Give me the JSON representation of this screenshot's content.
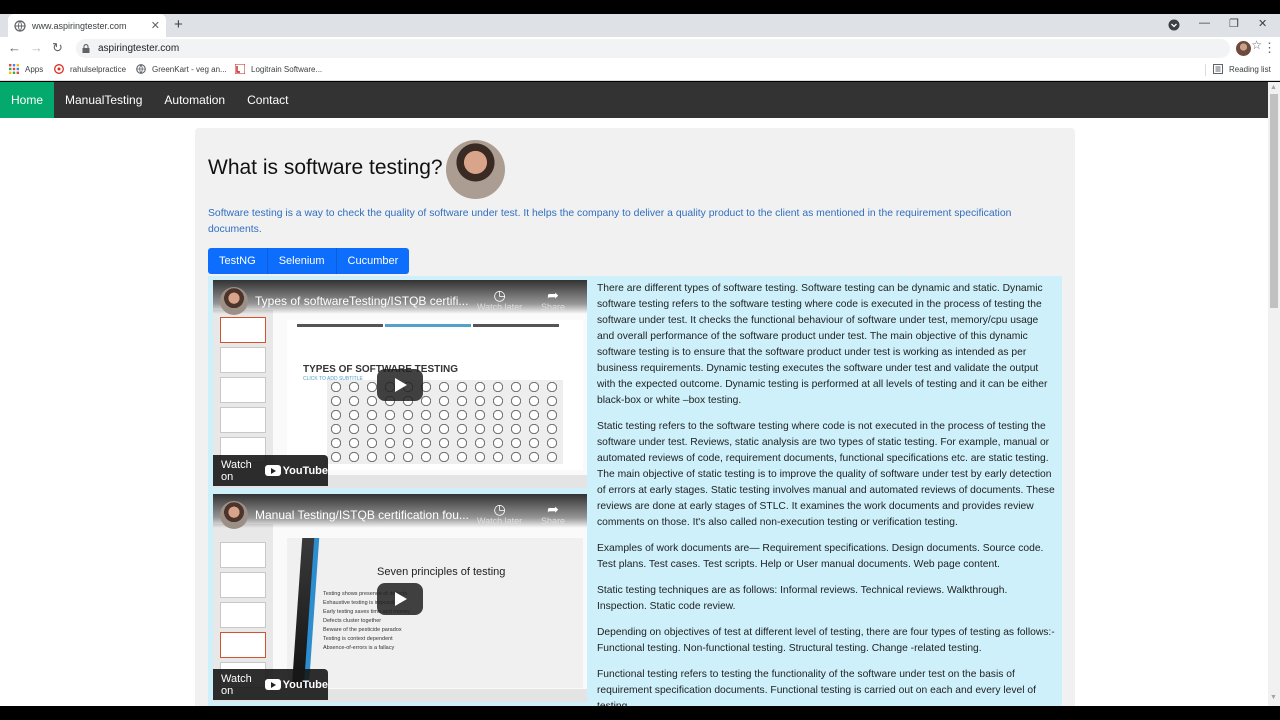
{
  "browser": {
    "tab_title": "www.aspiringtester.com",
    "tab_close": "✕",
    "new_tab": "+",
    "url": "aspiringtester.com",
    "bookmarks": [
      {
        "label": "Apps"
      },
      {
        "label": "rahulselpractice"
      },
      {
        "label": "GreenKart - veg an..."
      },
      {
        "label": "Logitrain Software..."
      }
    ],
    "reading_list": "Reading list",
    "icons": {
      "back": "←",
      "forward": "→",
      "reload": "↻",
      "star": "☆",
      "menu": "⋮",
      "minimize": "—",
      "restore": "❐",
      "close": "✕"
    }
  },
  "nav": {
    "items": [
      "Home",
      "ManualTesting",
      "Automation",
      "Contact"
    ],
    "active": "Home",
    "active_color": "#04aa6d"
  },
  "main": {
    "heading": "What is software testing?",
    "intro": "Software testing is a way to check the quality of software under test. It helps the company to deliver a quality product to the client as mentioned in the requirement specification documents.",
    "tabs": [
      "TestNG",
      "Selenium",
      "Cucumber"
    ],
    "tab_color": "#0d6efd",
    "panel_color": "#cdf0fb"
  },
  "videos": [
    {
      "title": "Types of softwareTesting/ISTQB certifi...",
      "slide_heading": "TYPES OF SOFTWARE TESTING",
      "slide_sub": "CLICK TO ADD SUBTITLE",
      "watch_later": "Watch later",
      "share": "Share",
      "watch_on": "Watch on",
      "youtube": "YouTube"
    },
    {
      "title": "Manual Testing/ISTQB certification fou...",
      "slide_heading": "Seven principles of testing",
      "principles": [
        "Testing shows presence of defects",
        "Exhaustive testing is impossible",
        "Early testing saves time and money",
        "Defects cluster together",
        "Beware of the pesticide paradox",
        "Testing is context dependent",
        "Absence-of-errors is a fallacy"
      ],
      "watch_later": "Watch later",
      "share": "Share",
      "watch_on": "Watch on",
      "youtube": "YouTube"
    }
  ],
  "article": [
    "There are different types of software testing. Software testing can be dynamic and static. Dynamic software testing refers to the software testing where code is executed in the process of testing the software under test. It checks the functional behaviour of software under test, memory/cpu usage and overall performance of the software product under test. The main objective of this dynamic software testing is to ensure that the software product under test is working as intended as per business requirements. Dynamic testing executes the software under test and validate the output with the expected outcome. Dynamic testing is performed at all levels of testing and it can be either black-box or white –box testing.",
    "Static testing refers to the software testing where code is not executed in the process of testing the software under test. Reviews, static analysis are two types of static testing. For example, manual or automated reviews of code, requirement documents, functional specifications etc. are static testing. The main objective of static testing is to improve the quality of software under test by early detection of errors at early stages. Static testing involves manual and automated reviews of documents. These reviews are done at early stages of STLC. It examines the work documents and provides review comments on those. It's also called non-execution testing or verification testing.",
    "Examples of work documents are— Requirement specifications. Design documents. Source code. Test plans. Test cases. Test scripts. Help or User manual documents. Web page content.",
    "Static testing techniques are as follows: Informal reviews. Technical reviews. Walkthrough. Inspection. Static code review.",
    "Depending on objectives of test at different level of testing, there are four types of testing as follows:- Functional testing. Non-functional testing. Structural testing. Change -related testing.",
    "Functional testing refers to testing the functionality of the software under test on the basis of requirement specification documents. Functional testing is carried out on each and every level of testing."
  ]
}
